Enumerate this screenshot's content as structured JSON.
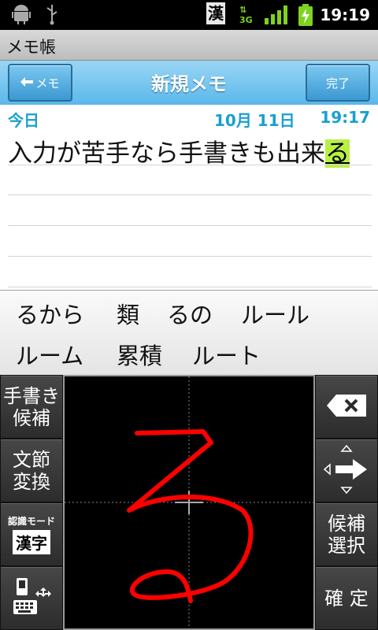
{
  "status_bar": {
    "ime_indicator": "漢",
    "network": "3G",
    "time": "19:19",
    "icons": [
      "android-icon",
      "usb-icon",
      "ime-kanji-icon",
      "network-3g-icon",
      "signal-icon",
      "battery-charging-icon"
    ]
  },
  "app": {
    "title": "メモ帳"
  },
  "header": {
    "back_label": "メモ",
    "title": "新規メモ",
    "done_label": "完了"
  },
  "memo": {
    "day_label": "今日",
    "date": "10月 11日",
    "time": "19:17",
    "text_committed": "入力が苦手なら手書きも出来",
    "text_composing": "る"
  },
  "candidates": {
    "row1": [
      "るから",
      "類",
      "るの",
      "ルール"
    ],
    "row2": [
      "ルーム",
      "累積",
      "ルート"
    ]
  },
  "keyboard": {
    "handwriting_candidates": "手書き\n候補",
    "phrase_convert": "文節\n変換",
    "recognition_mode_label": "認識モード",
    "recognition_mode_value": "漢字",
    "candidate_select": "候補\n選択",
    "confirm": "確 定",
    "colors": {
      "stroke": "#ff0000",
      "pad_bg": "#000000",
      "key_bg": "#3a3a3a"
    }
  }
}
